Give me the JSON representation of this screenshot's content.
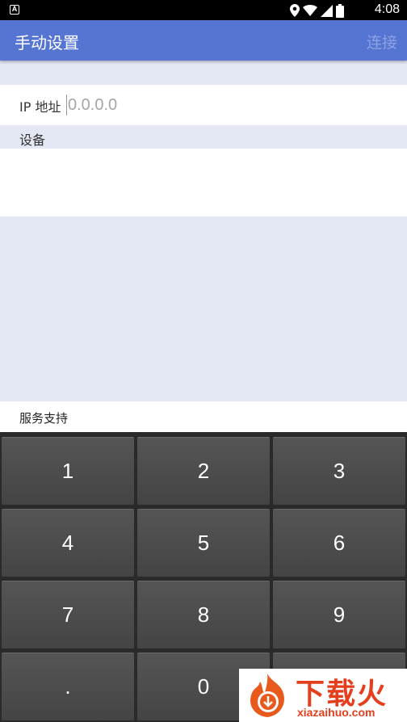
{
  "status_bar": {
    "time": "4:08",
    "icons": [
      "notification-a-icon",
      "location-icon",
      "wifi-icon",
      "signal-icon",
      "battery-icon"
    ]
  },
  "app_bar": {
    "title": "手动设置",
    "connect_label": "连接"
  },
  "ip_field": {
    "label": "IP 地址",
    "placeholder": "0.0.0.0",
    "value": ""
  },
  "devices": {
    "section_label": "设备",
    "items": []
  },
  "support": {
    "label": "服务支持"
  },
  "keypad": {
    "keys": [
      "1",
      "2",
      "3",
      "4",
      "5",
      "6",
      "7",
      "8",
      "9",
      ".",
      "0",
      ""
    ]
  },
  "watermark": {
    "title": "下载火",
    "url": "xiazaihuo.com"
  },
  "colors": {
    "app_bar": "#5675d3",
    "background": "#e4e7f4",
    "keypad": "#2a2a2a",
    "watermark_red": "#e53e1d"
  }
}
